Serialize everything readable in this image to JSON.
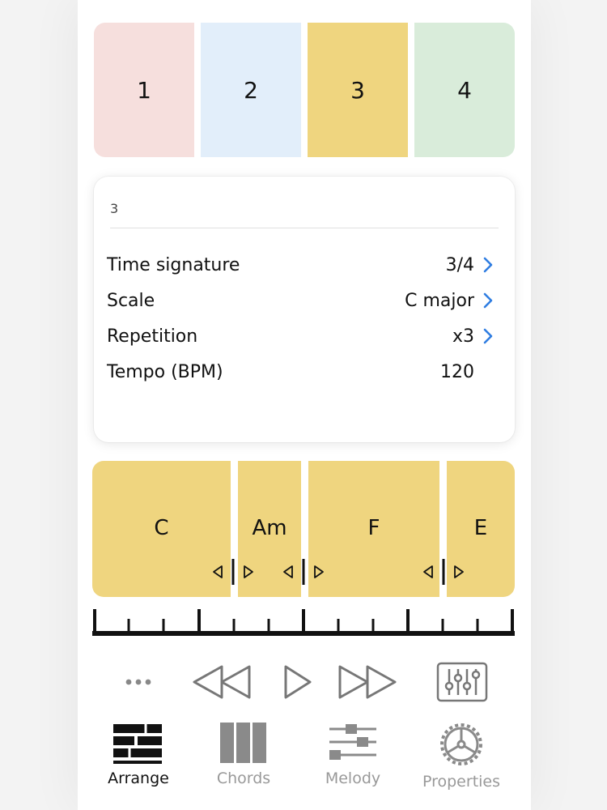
{
  "sections": [
    {
      "label": "1",
      "color": "#f6dfdd"
    },
    {
      "label": "2",
      "color": "#e2eefa"
    },
    {
      "label": "3",
      "color": "#efd57f"
    },
    {
      "label": "4",
      "color": "#d9ecda"
    }
  ],
  "card": {
    "title": "3",
    "rows": [
      {
        "label": "Time signature",
        "value": "3/4",
        "chevron": true
      },
      {
        "label": "Scale",
        "value": "C major",
        "chevron": true
      },
      {
        "label": "Repetition",
        "value": "x3",
        "chevron": true
      },
      {
        "label": "Tempo (BPM)",
        "value": "120",
        "chevron": false
      }
    ]
  },
  "chords": [
    "C",
    "Am",
    "F",
    "E"
  ],
  "chord_color": "#efd57f",
  "accent_color": "#2f7de1",
  "transport": {
    "more_icon": "ellipsis-icon",
    "rewind_icon": "rewind-icon",
    "play_icon": "play-icon",
    "forward_icon": "fast-forward-icon",
    "mixer_icon": "mixer-icon"
  },
  "tabs": [
    {
      "label": "Arrange",
      "icon": "bricks-icon",
      "active": true
    },
    {
      "label": "Chords",
      "icon": "columns-icon",
      "active": false
    },
    {
      "label": "Melody",
      "icon": "sliders-icon",
      "active": false
    },
    {
      "label": "Properties",
      "icon": "gear-icon",
      "active": false
    }
  ]
}
